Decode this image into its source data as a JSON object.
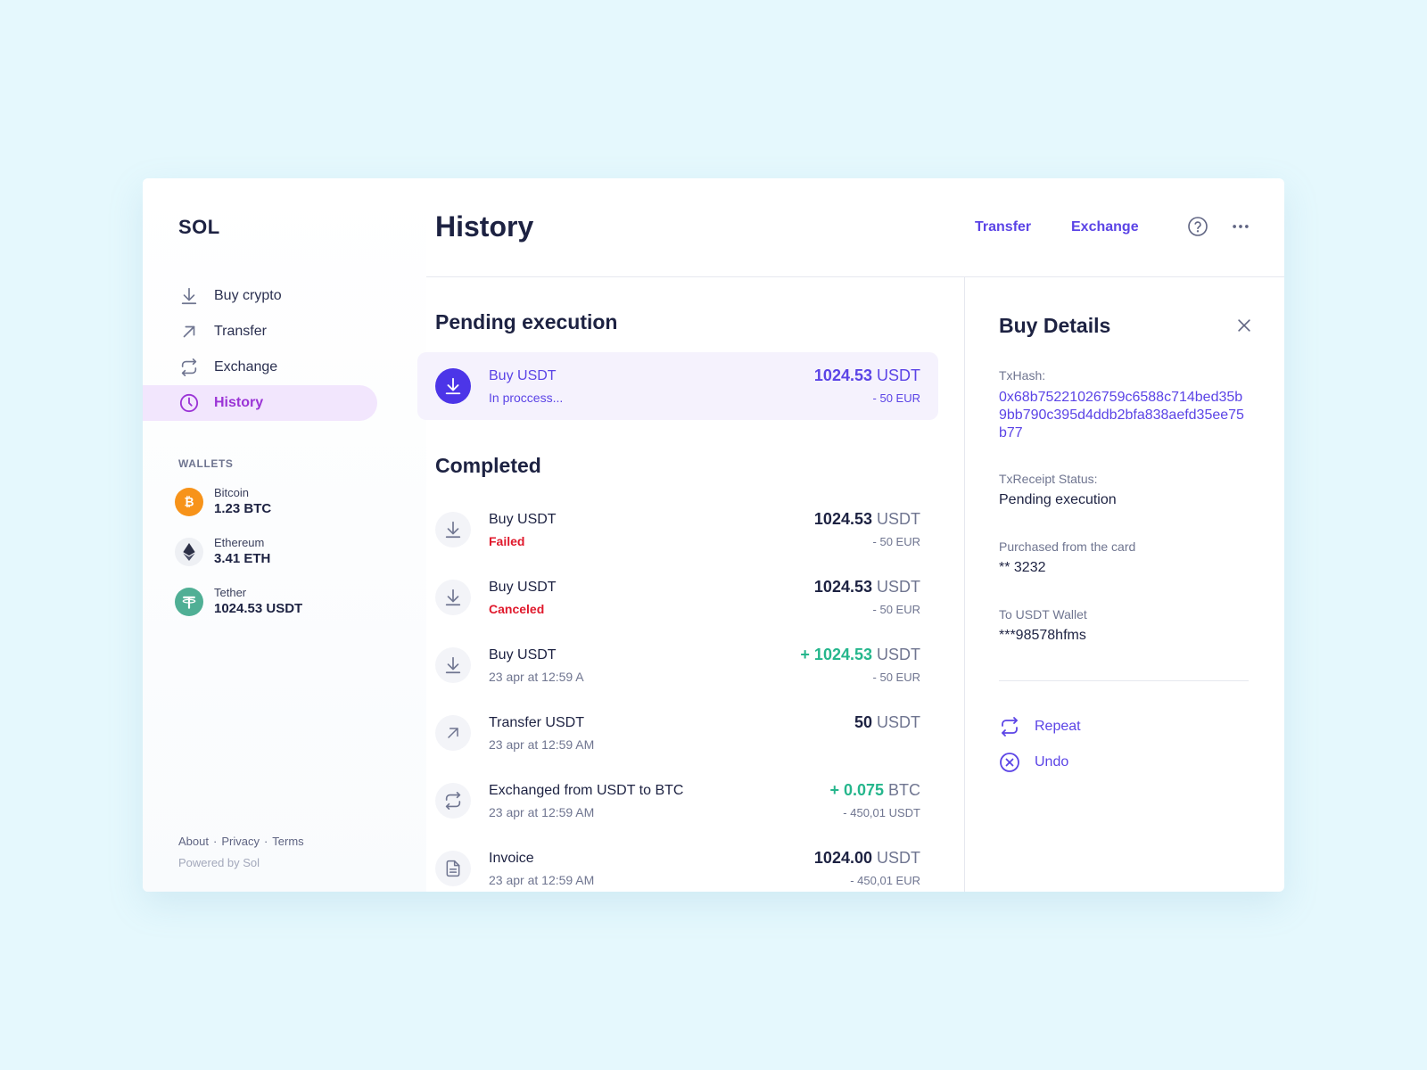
{
  "app": {
    "logo": "SOL",
    "title": "History"
  },
  "sidebar": {
    "nav": [
      {
        "label": "Buy crypto",
        "icon": "download-icon"
      },
      {
        "label": "Transfer",
        "icon": "arrow-up-right-icon"
      },
      {
        "label": "Exchange",
        "icon": "exchange-icon"
      },
      {
        "label": "History",
        "icon": "clock-icon",
        "active": true
      }
    ],
    "wallets_title": "WALLETS",
    "wallets": [
      {
        "name": "Bitcoin",
        "balance": "1.23 BTC",
        "icon": "bitcoin-icon",
        "color": "#f7931a"
      },
      {
        "name": "Ethereum",
        "balance": "3.41 ETH",
        "icon": "ethereum-icon",
        "color": "#eef0f4"
      },
      {
        "name": "Tether",
        "balance": "1024.53 USDT",
        "icon": "tether-icon",
        "color": "#50af95"
      }
    ],
    "footer": {
      "about": "About",
      "privacy": "Privacy",
      "terms": "Terms",
      "powered": "Powered by Sol"
    }
  },
  "header": {
    "transfer": "Transfer",
    "exchange": "Exchange",
    "help_icon": "help-circle-icon",
    "more_icon": "more-horizontal-icon"
  },
  "pending": {
    "title": "Pending execution",
    "items": [
      {
        "name": "Buy USDT",
        "sub": "In proccess...",
        "amount": "1024.53",
        "currency": "USDT",
        "secondary": "- 50 EUR",
        "icon": "download-icon"
      }
    ]
  },
  "completed": {
    "title": "Completed",
    "items": [
      {
        "name": "Buy USDT",
        "sub": "Failed",
        "amount": "1024.53",
        "currency": "USDT",
        "secondary": "- 50 EUR",
        "icon": "download-icon"
      },
      {
        "name": "Buy USDT",
        "sub": "Canceled",
        "amount": "1024.53",
        "currency": "USDT",
        "secondary": "- 50 EUR",
        "icon": "download-icon"
      },
      {
        "name": "Buy USDT",
        "sub": "23 apr at 12:59 A",
        "amount": "+ 1024.53",
        "currency": "USDT",
        "secondary": "- 50 EUR",
        "icon": "download-icon"
      },
      {
        "name": "Transfer USDT",
        "sub": "23 apr at 12:59 AM",
        "amount": "50",
        "currency": "USDT",
        "secondary": "",
        "icon": "arrow-up-right-icon"
      },
      {
        "name": "Exchanged from USDT to BTC",
        "sub": "23 apr at 12:59 AM",
        "amount": "+ 0.075",
        "currency": "BTC",
        "secondary": "- 450,01 USDT",
        "icon": "exchange-icon"
      },
      {
        "name": "Invoice",
        "sub": "23 apr at 12:59 AM",
        "amount": "1024.00",
        "currency": "USDT",
        "secondary": "- 450,01 EUR",
        "icon": "document-icon"
      }
    ]
  },
  "details": {
    "title": "Buy Details",
    "txhash_label": "TxHash:",
    "txhash": "0x68b75221026759c6588c714bed35b9bb790c395d4ddb2bfa838aefd35ee75b77",
    "status_label": "TxReceipt Status:",
    "status": "Pending execution",
    "card_label": "Purchased from the card",
    "card": "** 3232",
    "wallet_label": "To USDT Wallet",
    "wallet": "***98578hfms",
    "repeat": "Repeat",
    "undo": "Undo"
  },
  "colors": {
    "accent": "#5b44e6",
    "active_nav": "#9b34d6",
    "positive": "#25b68c",
    "failed": "#e0192c"
  }
}
